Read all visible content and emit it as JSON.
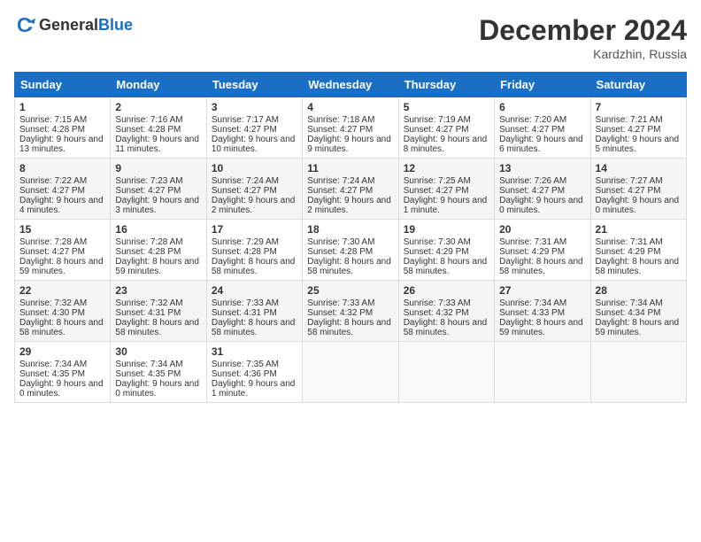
{
  "header": {
    "logo_general": "General",
    "logo_blue": "Blue",
    "month_title": "December 2024",
    "location": "Kardzhin, Russia"
  },
  "days_of_week": [
    "Sunday",
    "Monday",
    "Tuesday",
    "Wednesday",
    "Thursday",
    "Friday",
    "Saturday"
  ],
  "weeks": [
    [
      {
        "day": "1",
        "sunrise": "7:15 AM",
        "sunset": "4:28 PM",
        "daylight": "9 hours and 13 minutes."
      },
      {
        "day": "2",
        "sunrise": "7:16 AM",
        "sunset": "4:28 PM",
        "daylight": "9 hours and 11 minutes."
      },
      {
        "day": "3",
        "sunrise": "7:17 AM",
        "sunset": "4:27 PM",
        "daylight": "9 hours and 10 minutes."
      },
      {
        "day": "4",
        "sunrise": "7:18 AM",
        "sunset": "4:27 PM",
        "daylight": "9 hours and 9 minutes."
      },
      {
        "day": "5",
        "sunrise": "7:19 AM",
        "sunset": "4:27 PM",
        "daylight": "9 hours and 8 minutes."
      },
      {
        "day": "6",
        "sunrise": "7:20 AM",
        "sunset": "4:27 PM",
        "daylight": "9 hours and 6 minutes."
      },
      {
        "day": "7",
        "sunrise": "7:21 AM",
        "sunset": "4:27 PM",
        "daylight": "9 hours and 5 minutes."
      }
    ],
    [
      {
        "day": "8",
        "sunrise": "7:22 AM",
        "sunset": "4:27 PM",
        "daylight": "9 hours and 4 minutes."
      },
      {
        "day": "9",
        "sunrise": "7:23 AM",
        "sunset": "4:27 PM",
        "daylight": "9 hours and 3 minutes."
      },
      {
        "day": "10",
        "sunrise": "7:24 AM",
        "sunset": "4:27 PM",
        "daylight": "9 hours and 2 minutes."
      },
      {
        "day": "11",
        "sunrise": "7:24 AM",
        "sunset": "4:27 PM",
        "daylight": "9 hours and 2 minutes."
      },
      {
        "day": "12",
        "sunrise": "7:25 AM",
        "sunset": "4:27 PM",
        "daylight": "9 hours and 1 minute."
      },
      {
        "day": "13",
        "sunrise": "7:26 AM",
        "sunset": "4:27 PM",
        "daylight": "9 hours and 0 minutes."
      },
      {
        "day": "14",
        "sunrise": "7:27 AM",
        "sunset": "4:27 PM",
        "daylight": "9 hours and 0 minutes."
      }
    ],
    [
      {
        "day": "15",
        "sunrise": "7:28 AM",
        "sunset": "4:27 PM",
        "daylight": "8 hours and 59 minutes."
      },
      {
        "day": "16",
        "sunrise": "7:28 AM",
        "sunset": "4:28 PM",
        "daylight": "8 hours and 59 minutes."
      },
      {
        "day": "17",
        "sunrise": "7:29 AM",
        "sunset": "4:28 PM",
        "daylight": "8 hours and 58 minutes."
      },
      {
        "day": "18",
        "sunrise": "7:30 AM",
        "sunset": "4:28 PM",
        "daylight": "8 hours and 58 minutes."
      },
      {
        "day": "19",
        "sunrise": "7:30 AM",
        "sunset": "4:29 PM",
        "daylight": "8 hours and 58 minutes."
      },
      {
        "day": "20",
        "sunrise": "7:31 AM",
        "sunset": "4:29 PM",
        "daylight": "8 hours and 58 minutes."
      },
      {
        "day": "21",
        "sunrise": "7:31 AM",
        "sunset": "4:29 PM",
        "daylight": "8 hours and 58 minutes."
      }
    ],
    [
      {
        "day": "22",
        "sunrise": "7:32 AM",
        "sunset": "4:30 PM",
        "daylight": "8 hours and 58 minutes."
      },
      {
        "day": "23",
        "sunrise": "7:32 AM",
        "sunset": "4:31 PM",
        "daylight": "8 hours and 58 minutes."
      },
      {
        "day": "24",
        "sunrise": "7:33 AM",
        "sunset": "4:31 PM",
        "daylight": "8 hours and 58 minutes."
      },
      {
        "day": "25",
        "sunrise": "7:33 AM",
        "sunset": "4:32 PM",
        "daylight": "8 hours and 58 minutes."
      },
      {
        "day": "26",
        "sunrise": "7:33 AM",
        "sunset": "4:32 PM",
        "daylight": "8 hours and 58 minutes."
      },
      {
        "day": "27",
        "sunrise": "7:34 AM",
        "sunset": "4:33 PM",
        "daylight": "8 hours and 59 minutes."
      },
      {
        "day": "28",
        "sunrise": "7:34 AM",
        "sunset": "4:34 PM",
        "daylight": "8 hours and 59 minutes."
      }
    ],
    [
      {
        "day": "29",
        "sunrise": "7:34 AM",
        "sunset": "4:35 PM",
        "daylight": "9 hours and 0 minutes."
      },
      {
        "day": "30",
        "sunrise": "7:34 AM",
        "sunset": "4:35 PM",
        "daylight": "9 hours and 0 minutes."
      },
      {
        "day": "31",
        "sunrise": "7:35 AM",
        "sunset": "4:36 PM",
        "daylight": "9 hours and 1 minute."
      },
      null,
      null,
      null,
      null
    ]
  ]
}
